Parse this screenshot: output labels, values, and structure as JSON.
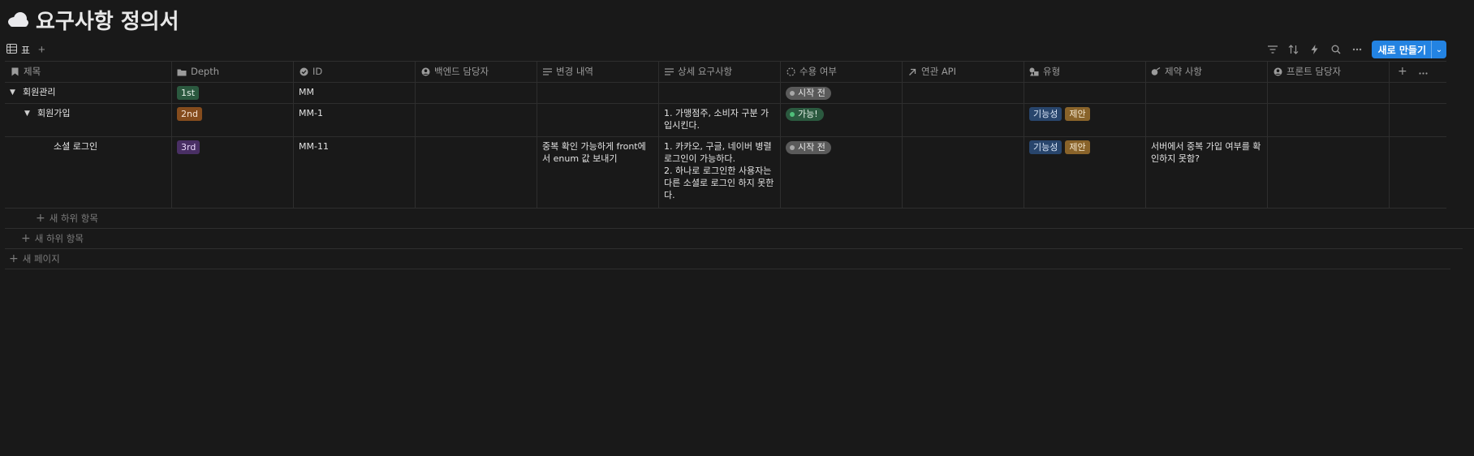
{
  "page": {
    "title": "요구사항 정의서"
  },
  "view": {
    "tab_label": "표",
    "add_view": "+"
  },
  "toolbar": {
    "new_label": "새로 만들기",
    "new_caret": "⌄"
  },
  "columns": [
    {
      "label": "제목",
      "icon": "bookmark-icon"
    },
    {
      "label": "Depth",
      "icon": "folder-icon"
    },
    {
      "label": "ID",
      "icon": "check-circle-icon"
    },
    {
      "label": "백엔드 담당자",
      "icon": "person-icon"
    },
    {
      "label": "변경 내역",
      "icon": "text-lines-icon"
    },
    {
      "label": "상세 요구사항",
      "icon": "text-lines-icon"
    },
    {
      "label": "수용 여부",
      "icon": "status-spinner-icon"
    },
    {
      "label": "연관 API",
      "icon": "arrow-up-right-icon"
    },
    {
      "label": "유형",
      "icon": "shapes-icon"
    },
    {
      "label": "제약 사항",
      "icon": "tag-icon"
    },
    {
      "label": "프론트 담당자",
      "icon": "person-icon"
    }
  ],
  "rows": [
    {
      "title": "회원관리",
      "depth": "1st",
      "id": "MM",
      "changes": "",
      "detail": "",
      "status": "시작 전",
      "types": []
    },
    {
      "title": "회원가입",
      "depth": "2nd",
      "id": "MM-1",
      "changes": "",
      "detail": "1. 가맹점주, 소비자 구분 가입시킨다.",
      "status": "가능!",
      "types": [
        "기능성",
        "제안"
      ]
    },
    {
      "title": "소셜 로그인",
      "depth": "3rd",
      "id": "MM-11",
      "changes": "중복 확인 가능하게 front에서 enum 값 보내기",
      "detail_lines": [
        "1. 카카오, 구글, 네이버 병렬로그인이 가능하다.",
        "2. 하나로 로그인한 사용자는 다른 소셜로 로그인 하지 못한다."
      ],
      "status": "시작 전",
      "types": [
        "기능성",
        "제안"
      ],
      "constraint": "서버에서 중복 가입 여부를 확인하지 못함?"
    }
  ],
  "add_sub_item": "새 하위 항목",
  "add_page": "새 페이지"
}
